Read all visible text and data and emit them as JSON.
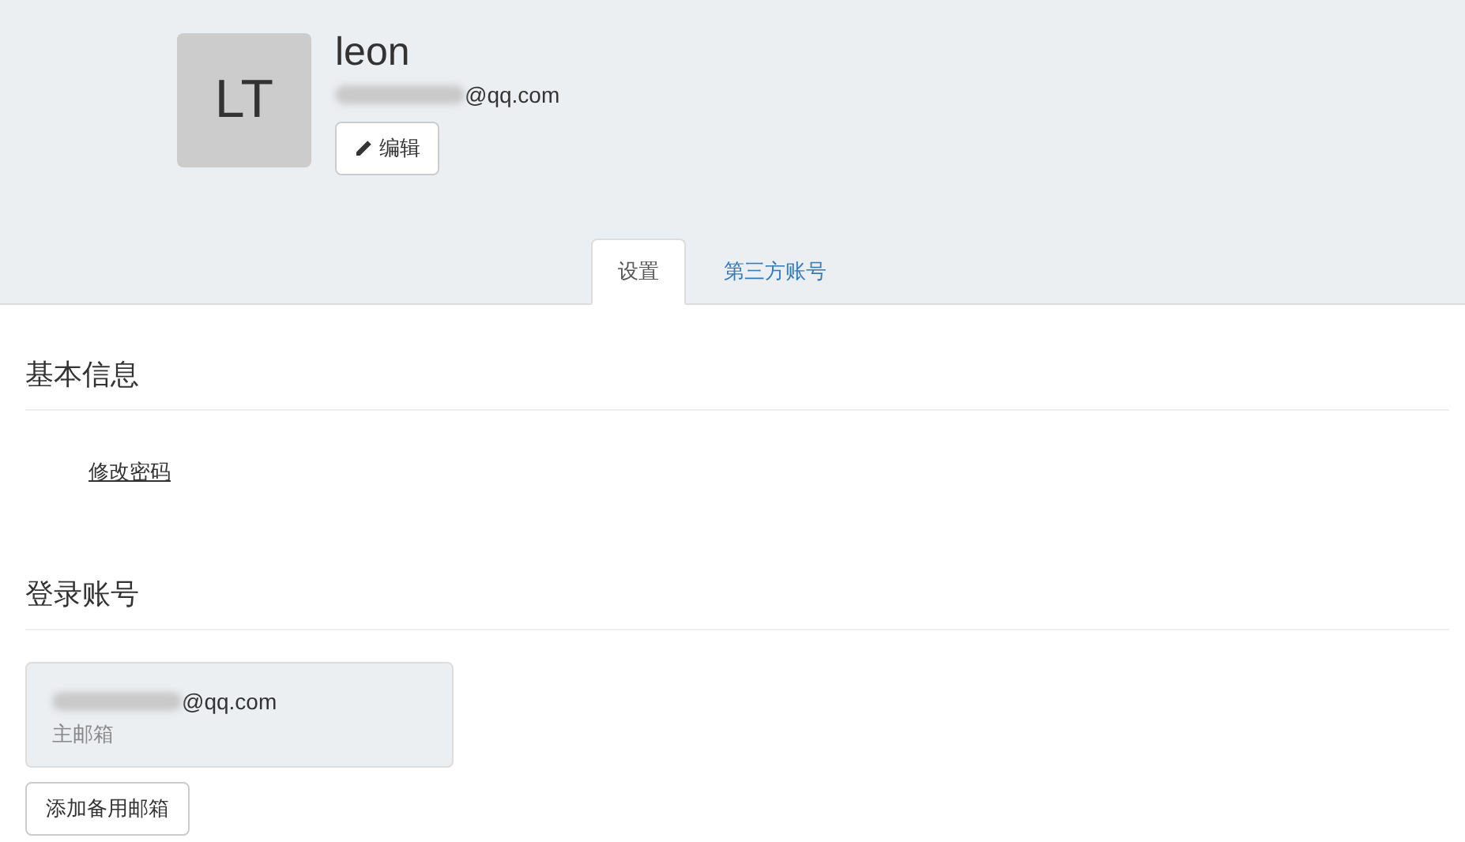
{
  "profile": {
    "initials": "LT",
    "name": "leon",
    "email": "@qq.com",
    "edit_button": "编辑"
  },
  "tabs": [
    {
      "label": "设置",
      "selected": true
    },
    {
      "label": "第三方账号",
      "selected": false
    }
  ],
  "basic_info": {
    "title": "基本信息",
    "change_password_link": "修改密码"
  },
  "login_accounts": {
    "title": "登录账号",
    "accounts": [
      {
        "email": "@qq.com",
        "label": "主邮箱"
      }
    ],
    "add_button": "添加备用邮箱"
  }
}
